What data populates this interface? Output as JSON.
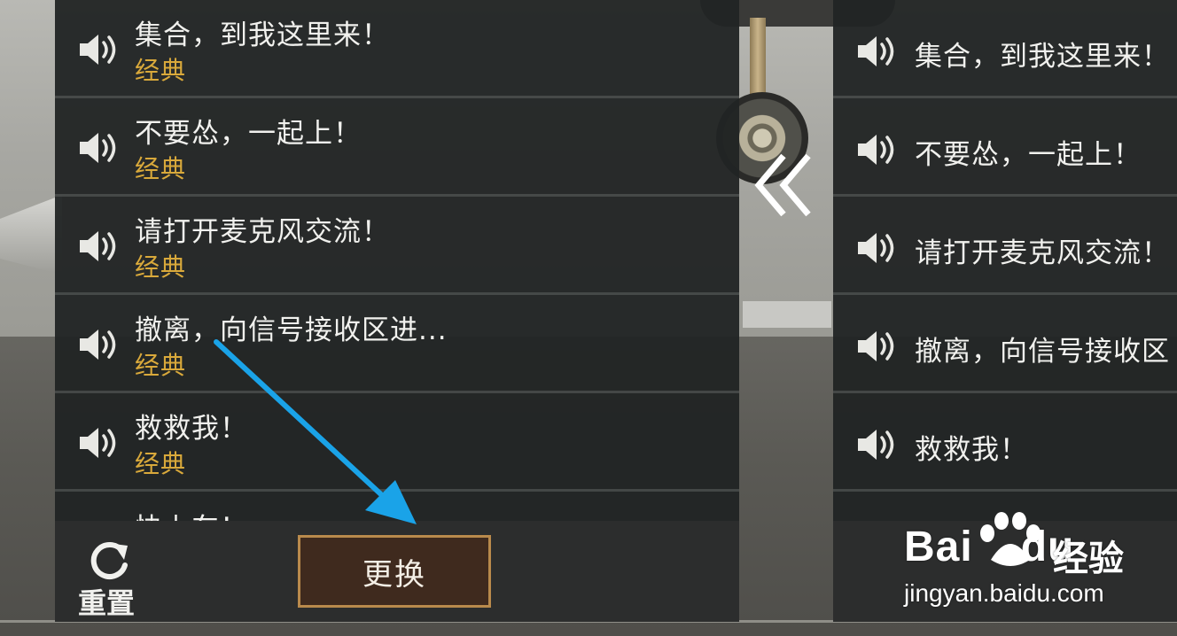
{
  "left_panel": {
    "items": [
      {
        "text": "集合，到我这里来！",
        "tag": "经典"
      },
      {
        "text": "不要怂，一起上！",
        "tag": "经典"
      },
      {
        "text": "请打开麦克风交流！",
        "tag": "经典"
      },
      {
        "text": "撤离，向信号接收区进...",
        "tag": "经典"
      },
      {
        "text": "救救我！",
        "tag": "经典"
      },
      {
        "text": "快上车！",
        "tag": ""
      }
    ],
    "reset_label": "重置",
    "swap_label": "更换"
  },
  "right_panel": {
    "items": [
      {
        "text": "集合，到我这里来！"
      },
      {
        "text": "不要怂，一起上！"
      },
      {
        "text": "请打开麦克风交流！"
      },
      {
        "text": "撤离，向信号接收区"
      },
      {
        "text": "救救我！"
      }
    ]
  },
  "watermark": {
    "brand_bai": "Bai",
    "brand_du": "du",
    "brand_cn": "经验",
    "url": "jingyan.baidu.com"
  },
  "colors": {
    "tag": "#d9a93b",
    "button_bg": "#3f2a1e",
    "button_border": "#b98a4c",
    "annotation_arrow": "#1aa3e8"
  },
  "icons": {
    "speaker": "speaker-icon",
    "reset": "refresh-icon",
    "collapse": "double-chevron-left-icon",
    "annotation": "arrow-icon"
  }
}
